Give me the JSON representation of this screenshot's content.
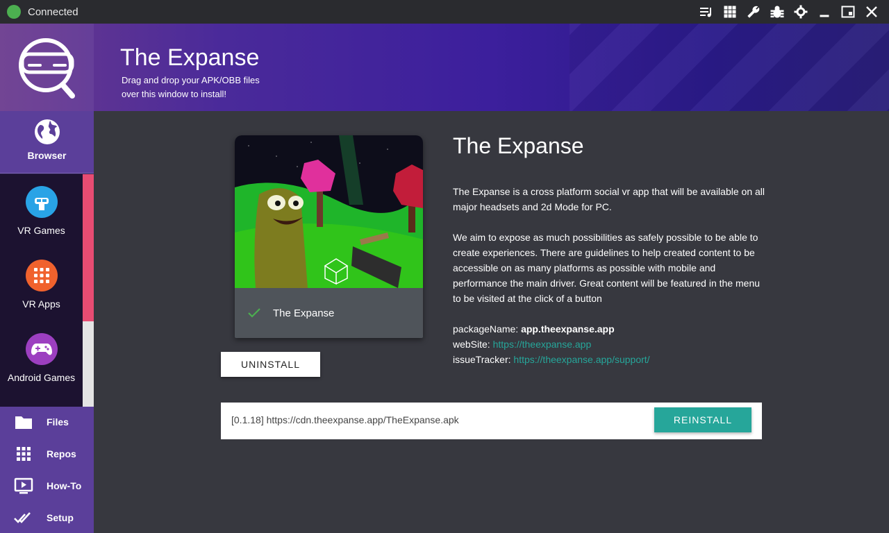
{
  "titlebar": {
    "status": "Connected",
    "status_color": "#4caf50",
    "icons": [
      "queue-icon",
      "grid-icon",
      "wrench-icon",
      "bug-icon",
      "gear-icon",
      "minimize-icon",
      "restore-icon",
      "close-icon"
    ]
  },
  "header": {
    "title": "The Expanse",
    "subtitle": "Drag and drop your APK/OBB files over this window to install!"
  },
  "sidebar": {
    "browser": {
      "label": "Browser",
      "icon": "globe-icon"
    },
    "categories": [
      {
        "label": "VR Games",
        "icon": "vr-player-icon",
        "color": "#29a3e6"
      },
      {
        "label": "VR Apps",
        "icon": "apps-grid-icon",
        "color": "#f0622d"
      },
      {
        "label": "Android Games",
        "icon": "gamepad-icon",
        "color": "#9c3fc0"
      }
    ],
    "links": [
      {
        "label": "Files",
        "icon": "folder-icon"
      },
      {
        "label": "Repos",
        "icon": "grid-icon"
      },
      {
        "label": "How-To",
        "icon": "play-video-icon"
      },
      {
        "label": "Setup",
        "icon": "double-check-icon"
      }
    ]
  },
  "card": {
    "name": "The Expanse",
    "installed": true
  },
  "actions": {
    "uninstall": "UNINSTALL",
    "reinstall": "REINSTALL"
  },
  "detail": {
    "title": "The Expanse",
    "description": [
      "The Expanse is a cross platform social vr app that will be available on all major headsets and 2d Mode for PC.",
      "We aim to expose as much possibilities as safely possible to be able to create experiences. There are guidelines to help created content to be accessible on as many platforms as possible with mobile and performance the main driver. Great content will be featured in the menu to be visited at the click of a button"
    ],
    "package_label": "packageName:",
    "package_value": "app.theexpanse.app",
    "website_label": "webSite:",
    "website_value": "https://theexpanse.app",
    "tracker_label": "issueTracker:",
    "tracker_value": "https://theexpanse.app/support/"
  },
  "source": {
    "text": "[0.1.18] https://cdn.theexpanse.app/TheExpanse.apk"
  },
  "accent": "#26a69a"
}
